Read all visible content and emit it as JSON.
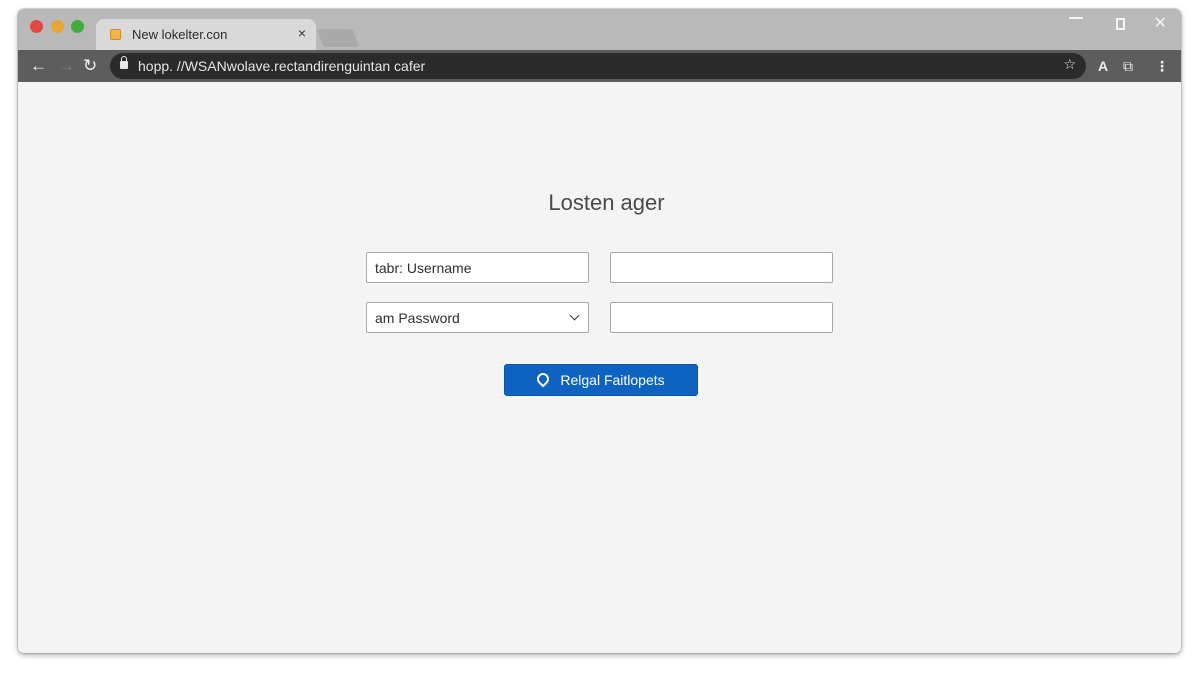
{
  "browser": {
    "tab": {
      "title": "New lokelter.con",
      "close_glyph": "×"
    },
    "nav": {
      "back_glyph": "←",
      "forward_glyph": "→",
      "reload_glyph": "↻"
    },
    "address_bar": {
      "url": "hopp. //WSANwolave.rectandirenguintan cafer"
    },
    "window_controls": {
      "close_glyph": "✕"
    },
    "toolbar_icons": {
      "star_glyph": "☆",
      "extension_glyph": "A",
      "cast_glyph": "⧉",
      "menu_glyph": "⋮"
    }
  },
  "page": {
    "title": "Losten ager",
    "fields": {
      "username_value": "tabr: Username",
      "username_secondary_value": "",
      "password_select_value": "am Password",
      "password_secondary_value": ""
    },
    "submit_button_label": "Relgal Faitlopets"
  },
  "colors": {
    "accent": "#0f63c0",
    "tab_strip": "#b9b9b9",
    "toolbar": "#5d5d5d",
    "omnibox": "#2b2b2b",
    "page_background": "#f4f4f4"
  }
}
